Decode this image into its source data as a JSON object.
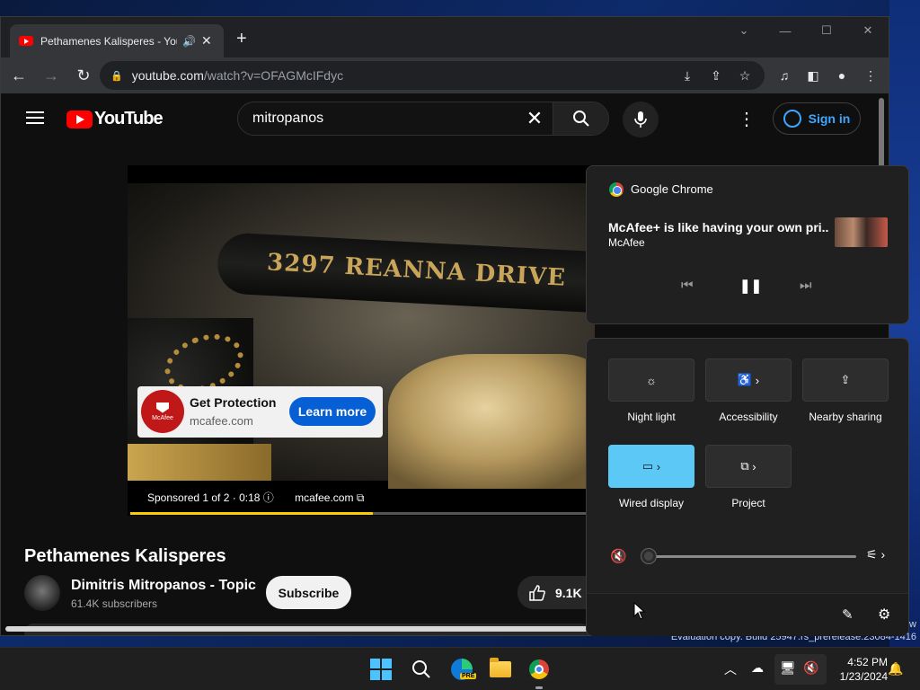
{
  "window": {
    "tab_title": "Pethamenes Kalisperes - You",
    "url_host": "youtube.com",
    "url_path": "/watch?v=OFAGMcIFdyc"
  },
  "youtube": {
    "logo_text": "YouTube",
    "search_value": "mitropanos",
    "signin_label": "Sign in",
    "video_title": "Pethamenes Kalisperes",
    "channel_name": "Dimitris Mitropanos - Topic",
    "subscribers": "61.4K subscribers",
    "subscribe_label": "Subscribe",
    "like_count": "9.1K",
    "ad": {
      "title": "Get Protection",
      "domain": "mcafee.com",
      "cta": "Learn more",
      "logo_text": "McAfee",
      "sponsored": "Sponsored 1 of 2 · 0:18",
      "sponsored_domain": "mcafee.com",
      "progress": 0.53
    },
    "frame_text": "3297 REANNA DRIVE"
  },
  "media_flyout": {
    "app": "Google Chrome",
    "title": "McAfee+ is like having your own pri...",
    "artist": "McAfee"
  },
  "quick_settings": {
    "tiles": [
      {
        "label": "Night light"
      },
      {
        "label": "Accessibility"
      },
      {
        "label": "Nearby sharing"
      },
      {
        "label": "Wired display",
        "active": true
      },
      {
        "label": "Project"
      }
    ],
    "volume": 0
  },
  "desktop": {
    "watermark_line1": "w",
    "watermark_line2": "Evaluation copy. Build 25947.rs_prerelease.23084-1416"
  },
  "taskbar": {
    "edge_badge": "PRE",
    "time": "4:52 PM",
    "date": "1/23/2024"
  },
  "colors": {
    "accent": "#5bc8f5",
    "youtube_red": "#ff0000",
    "ad_progress": "#ffcc00",
    "link_blue": "#3ea6ff"
  }
}
